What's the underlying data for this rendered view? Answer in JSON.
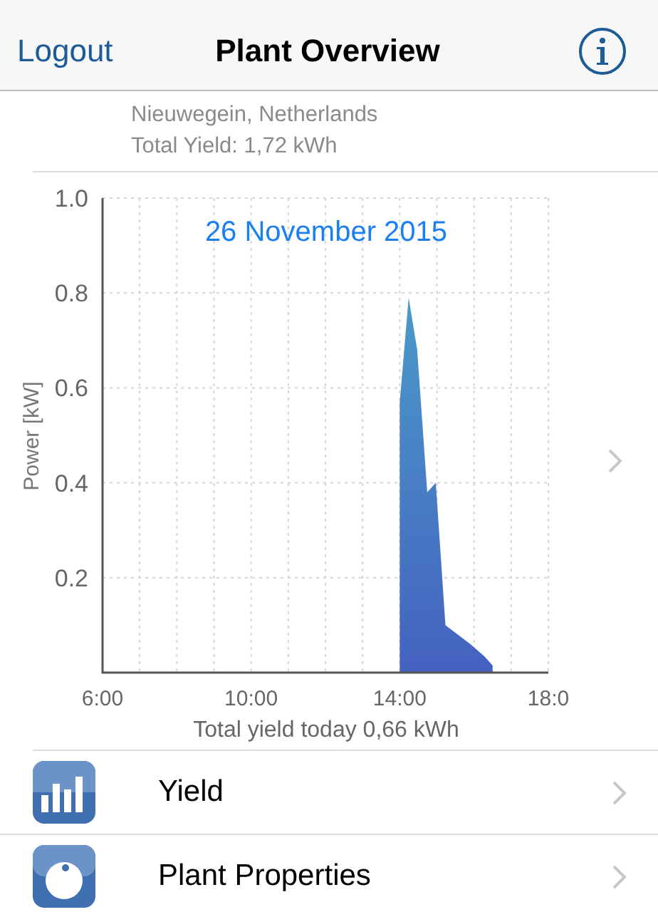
{
  "nav_bar": {
    "left_button": "Logout",
    "title": "Plant Overview"
  },
  "plant": {
    "location": "Nieuwegein, Netherlands",
    "total_yield": "Total Yield: 1,72 kWh"
  },
  "chart_card": {
    "chart_data": {
      "type": "area",
      "title": "26 November 2015",
      "xlabel": "Total yield today 0,66 kWh",
      "ylabel": "Power [kW]",
      "x": [
        14.0,
        14.24,
        14.47,
        14.74,
        14.97,
        15.23,
        15.9,
        16.27,
        16.5
      ],
      "grid": true,
      "series": [
        {
          "color": "#4462c0",
          "values": [
            0.57,
            0.79,
            0.68,
            0.38,
            0.4,
            0.1,
            0.06,
            0.035,
            0.015
          ]
        }
      ],
      "xlim": [
        6,
        18
      ],
      "ylim": [
        0,
        1
      ],
      "xticks": [
        {
          "value": 6,
          "label": "6:00"
        },
        {
          "value": 10,
          "label": "10:00"
        },
        {
          "value": 14,
          "label": "14:00"
        },
        {
          "value": 18,
          "label": "18:0"
        }
      ],
      "yticks": [
        {
          "value": 0.2,
          "label": "0.2"
        },
        {
          "value": 0.4,
          "label": "0.4"
        },
        {
          "value": 0.6,
          "label": "0.6"
        },
        {
          "value": 0.8,
          "label": "0.8"
        },
        {
          "value": 1,
          "label": "1.0"
        }
      ]
    }
  },
  "menu": [
    {
      "kind": "yield",
      "label": "Yield"
    },
    {
      "kind": "properties",
      "label": "Plant Properties"
    }
  ]
}
